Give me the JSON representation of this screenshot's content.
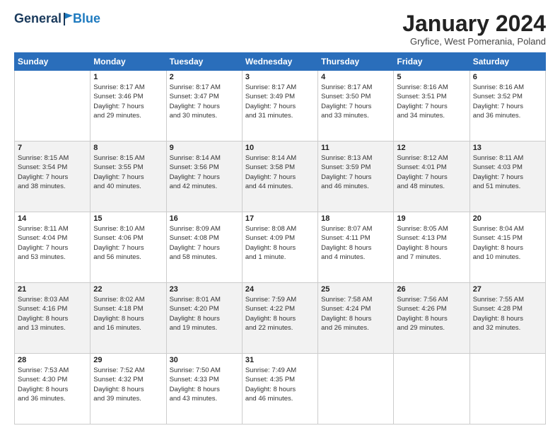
{
  "logo": {
    "general": "General",
    "blue": "Blue"
  },
  "title": "January 2024",
  "location": "Gryfice, West Pomerania, Poland",
  "days_of_week": [
    "Sunday",
    "Monday",
    "Tuesday",
    "Wednesday",
    "Thursday",
    "Friday",
    "Saturday"
  ],
  "weeks": [
    [
      {
        "day": "",
        "detail": ""
      },
      {
        "day": "1",
        "detail": "Sunrise: 8:17 AM\nSunset: 3:46 PM\nDaylight: 7 hours\nand 29 minutes."
      },
      {
        "day": "2",
        "detail": "Sunrise: 8:17 AM\nSunset: 3:47 PM\nDaylight: 7 hours\nand 30 minutes."
      },
      {
        "day": "3",
        "detail": "Sunrise: 8:17 AM\nSunset: 3:49 PM\nDaylight: 7 hours\nand 31 minutes."
      },
      {
        "day": "4",
        "detail": "Sunrise: 8:17 AM\nSunset: 3:50 PM\nDaylight: 7 hours\nand 33 minutes."
      },
      {
        "day": "5",
        "detail": "Sunrise: 8:16 AM\nSunset: 3:51 PM\nDaylight: 7 hours\nand 34 minutes."
      },
      {
        "day": "6",
        "detail": "Sunrise: 8:16 AM\nSunset: 3:52 PM\nDaylight: 7 hours\nand 36 minutes."
      }
    ],
    [
      {
        "day": "7",
        "detail": "Sunrise: 8:15 AM\nSunset: 3:54 PM\nDaylight: 7 hours\nand 38 minutes."
      },
      {
        "day": "8",
        "detail": "Sunrise: 8:15 AM\nSunset: 3:55 PM\nDaylight: 7 hours\nand 40 minutes."
      },
      {
        "day": "9",
        "detail": "Sunrise: 8:14 AM\nSunset: 3:56 PM\nDaylight: 7 hours\nand 42 minutes."
      },
      {
        "day": "10",
        "detail": "Sunrise: 8:14 AM\nSunset: 3:58 PM\nDaylight: 7 hours\nand 44 minutes."
      },
      {
        "day": "11",
        "detail": "Sunrise: 8:13 AM\nSunset: 3:59 PM\nDaylight: 7 hours\nand 46 minutes."
      },
      {
        "day": "12",
        "detail": "Sunrise: 8:12 AM\nSunset: 4:01 PM\nDaylight: 7 hours\nand 48 minutes."
      },
      {
        "day": "13",
        "detail": "Sunrise: 8:11 AM\nSunset: 4:03 PM\nDaylight: 7 hours\nand 51 minutes."
      }
    ],
    [
      {
        "day": "14",
        "detail": "Sunrise: 8:11 AM\nSunset: 4:04 PM\nDaylight: 7 hours\nand 53 minutes."
      },
      {
        "day": "15",
        "detail": "Sunrise: 8:10 AM\nSunset: 4:06 PM\nDaylight: 7 hours\nand 56 minutes."
      },
      {
        "day": "16",
        "detail": "Sunrise: 8:09 AM\nSunset: 4:08 PM\nDaylight: 7 hours\nand 58 minutes."
      },
      {
        "day": "17",
        "detail": "Sunrise: 8:08 AM\nSunset: 4:09 PM\nDaylight: 8 hours\nand 1 minute."
      },
      {
        "day": "18",
        "detail": "Sunrise: 8:07 AM\nSunset: 4:11 PM\nDaylight: 8 hours\nand 4 minutes."
      },
      {
        "day": "19",
        "detail": "Sunrise: 8:05 AM\nSunset: 4:13 PM\nDaylight: 8 hours\nand 7 minutes."
      },
      {
        "day": "20",
        "detail": "Sunrise: 8:04 AM\nSunset: 4:15 PM\nDaylight: 8 hours\nand 10 minutes."
      }
    ],
    [
      {
        "day": "21",
        "detail": "Sunrise: 8:03 AM\nSunset: 4:16 PM\nDaylight: 8 hours\nand 13 minutes."
      },
      {
        "day": "22",
        "detail": "Sunrise: 8:02 AM\nSunset: 4:18 PM\nDaylight: 8 hours\nand 16 minutes."
      },
      {
        "day": "23",
        "detail": "Sunrise: 8:01 AM\nSunset: 4:20 PM\nDaylight: 8 hours\nand 19 minutes."
      },
      {
        "day": "24",
        "detail": "Sunrise: 7:59 AM\nSunset: 4:22 PM\nDaylight: 8 hours\nand 22 minutes."
      },
      {
        "day": "25",
        "detail": "Sunrise: 7:58 AM\nSunset: 4:24 PM\nDaylight: 8 hours\nand 26 minutes."
      },
      {
        "day": "26",
        "detail": "Sunrise: 7:56 AM\nSunset: 4:26 PM\nDaylight: 8 hours\nand 29 minutes."
      },
      {
        "day": "27",
        "detail": "Sunrise: 7:55 AM\nSunset: 4:28 PM\nDaylight: 8 hours\nand 32 minutes."
      }
    ],
    [
      {
        "day": "28",
        "detail": "Sunrise: 7:53 AM\nSunset: 4:30 PM\nDaylight: 8 hours\nand 36 minutes."
      },
      {
        "day": "29",
        "detail": "Sunrise: 7:52 AM\nSunset: 4:32 PM\nDaylight: 8 hours\nand 39 minutes."
      },
      {
        "day": "30",
        "detail": "Sunrise: 7:50 AM\nSunset: 4:33 PM\nDaylight: 8 hours\nand 43 minutes."
      },
      {
        "day": "31",
        "detail": "Sunrise: 7:49 AM\nSunset: 4:35 PM\nDaylight: 8 hours\nand 46 minutes."
      },
      {
        "day": "",
        "detail": ""
      },
      {
        "day": "",
        "detail": ""
      },
      {
        "day": "",
        "detail": ""
      }
    ]
  ]
}
